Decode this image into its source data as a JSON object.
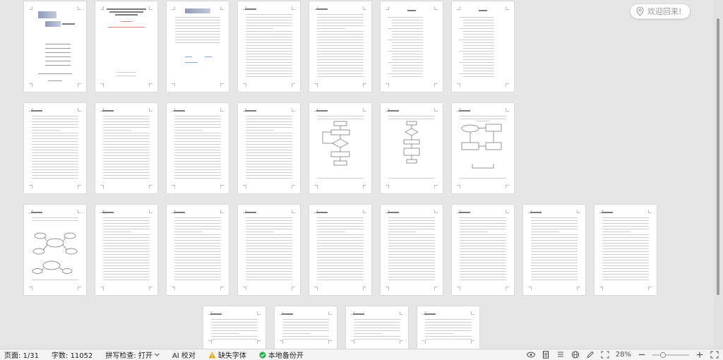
{
  "welcome_label": "欢迎回来!",
  "status": {
    "page": "页面: 1/31",
    "words": "字数: 11052",
    "spell": "拼写检查: 打开",
    "ai": "AI 校对",
    "missing_font": "缺失字体",
    "backup": "本地备份开",
    "zoom": "28%"
  },
  "cover": {
    "title_en": "Design and Implementation of the Publicity Website for the Big Data School of Tongren University",
    "note_red": "(Tongren University ...)"
  },
  "zoom_level": 0.28,
  "colors": {
    "accent_green": "#22b14c",
    "warning": "#f0a800",
    "workspace_bg": "#e6e6e6"
  }
}
